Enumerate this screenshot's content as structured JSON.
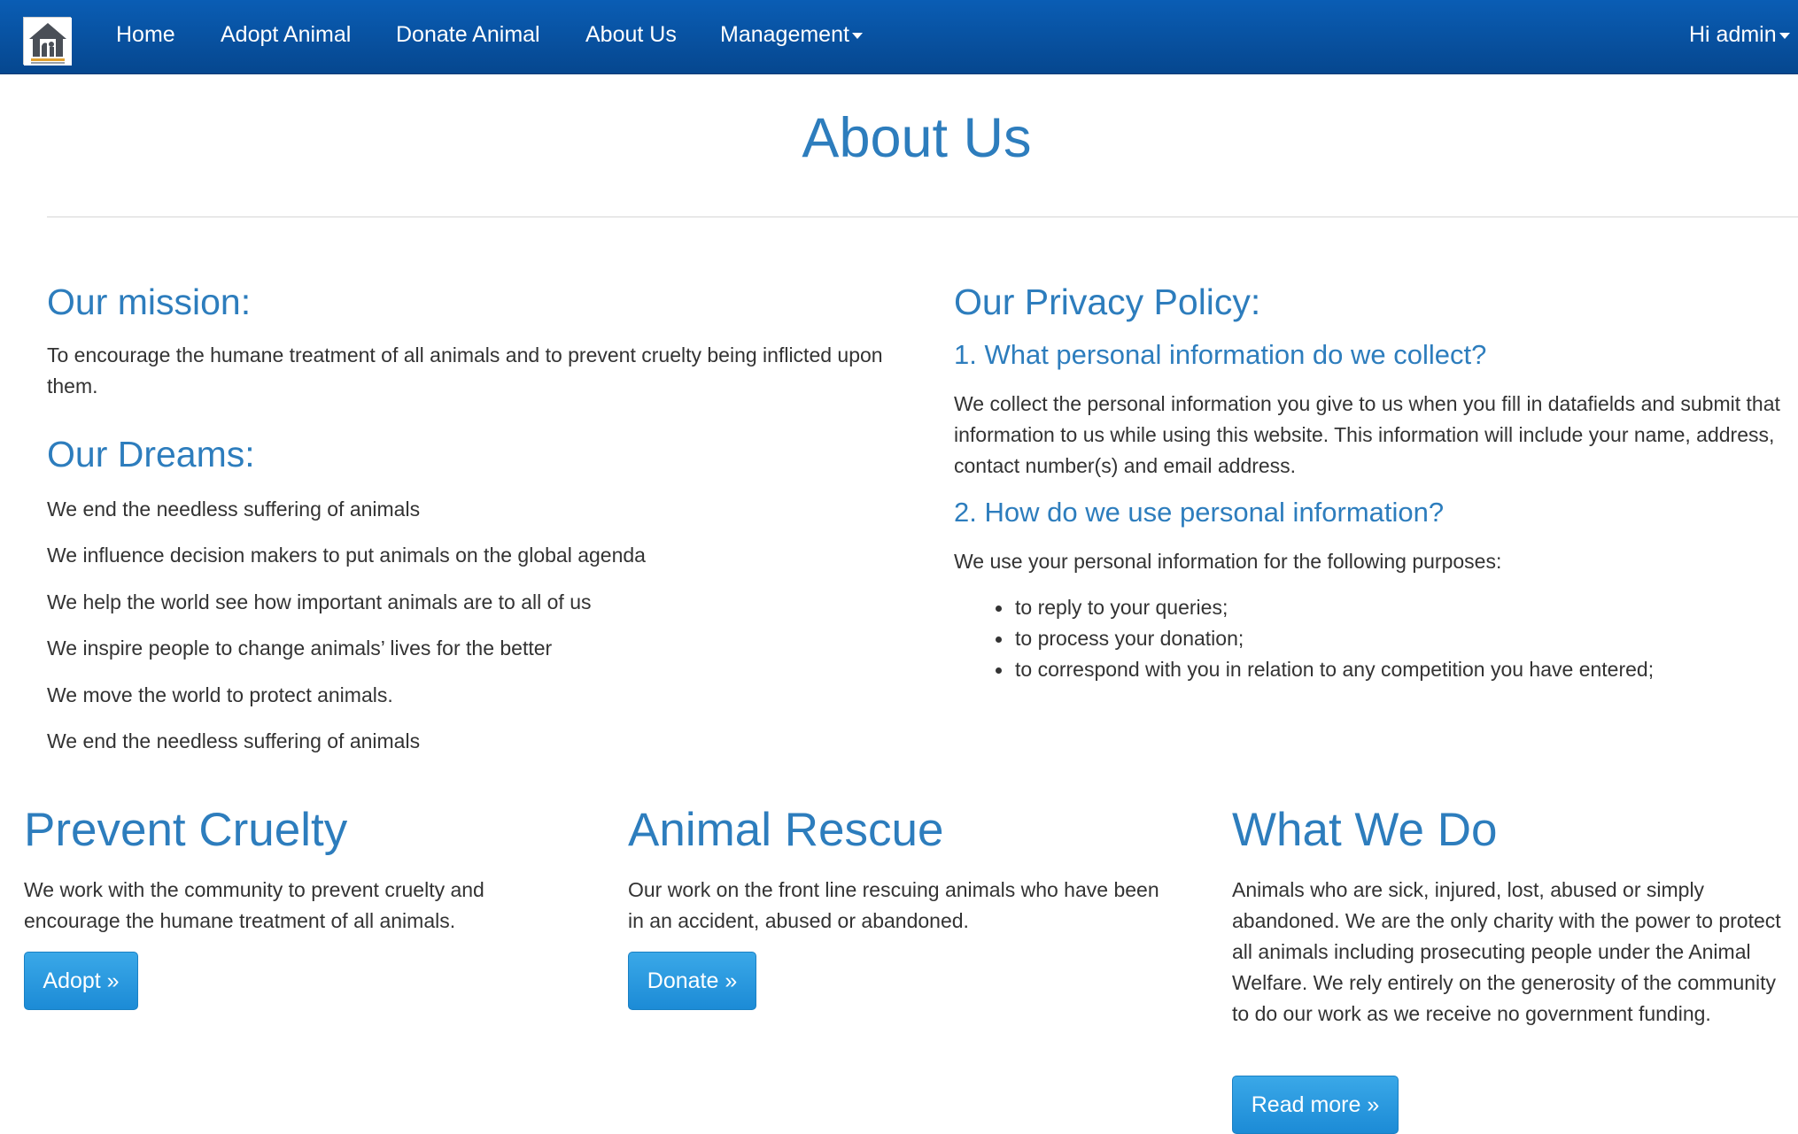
{
  "nav": {
    "logo_label": "logo",
    "items": [
      "Home",
      "Adopt Animal",
      "Donate Animal",
      "About Us",
      "Management"
    ],
    "user": "Hi admin"
  },
  "page": {
    "title": "About Us"
  },
  "mission": {
    "heading": "Our mission:",
    "text": "To encourage the humane treatment of all animals and to prevent cruelty being inflicted upon them."
  },
  "dreams": {
    "heading": "Our Dreams:",
    "items": [
      "We end the needless suffering of animals",
      "We influence decision makers to put animals on the global agenda",
      "We help the world see how important animals are to all of us",
      "We inspire people to change animals’ lives for the better",
      "We move the world to protect animals.",
      "We end the needless suffering of animals"
    ]
  },
  "privacy": {
    "heading": "Our Privacy Policy:",
    "q1": "1. What personal information do we collect?",
    "a1": "We collect the personal information you give to us when you fill in datafields and submit that information to us while using this website. This information will include your name, address, contact number(s) and email address.",
    "q2": "2. How do we use personal information?",
    "a2": "We use your personal information for the following purposes:",
    "purposes": [
      "to reply to your queries;",
      "to process your donation;",
      "to correspond with you in relation to any competition you have entered;"
    ]
  },
  "features": [
    {
      "heading": "Prevent Cruelty",
      "text": "We work with the community to prevent cruelty and encourage the humane treatment of all animals.",
      "button": "Adopt »"
    },
    {
      "heading": "Animal Rescue",
      "text": "Our work on the front line rescuing animals who have been in an accident, abused or abandoned.",
      "button": "Donate »"
    },
    {
      "heading": "What We Do",
      "text": "Animals who are sick, injured, lost, abused or simply abandoned. We are the only charity with the power to protect all animals including prosecuting people under the Animal Welfare. We rely entirely on the generosity of the community to do our work as we receive no government funding.",
      "button": "Read more »"
    }
  ],
  "colors": {
    "navbar": "#06478f",
    "heading": "#2d7dbd",
    "button": "#1c8bd6",
    "text": "#333333"
  }
}
